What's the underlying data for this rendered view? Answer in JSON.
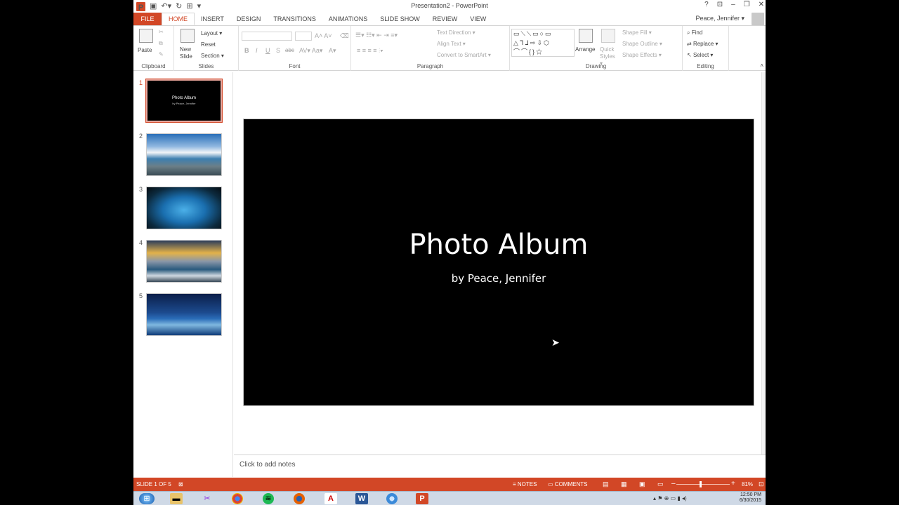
{
  "window": {
    "title": "Presentation2 - PowerPoint",
    "help": "?",
    "controls": [
      "restore-icon",
      "minimize-icon",
      "maximize-icon",
      "close-icon"
    ]
  },
  "user": {
    "name": "Peace, Jennifer ▾"
  },
  "tabs": [
    "FILE",
    "HOME",
    "INSERT",
    "DESIGN",
    "TRANSITIONS",
    "ANIMATIONS",
    "SLIDE SHOW",
    "REVIEW",
    "VIEW"
  ],
  "ribbon": {
    "clipboard": {
      "label": "Clipboard",
      "paste": "Paste"
    },
    "slides": {
      "label": "Slides",
      "new_slide": "New Slide",
      "layout": "Layout ▾",
      "reset": "Reset",
      "section": "Section ▾"
    },
    "font": {
      "label": "Font",
      "bold": "B",
      "italic": "I",
      "underline": "U",
      "shadow": "S",
      "strike": "abc"
    },
    "paragraph": {
      "label": "Paragraph",
      "text_direction": "Text Direction ▾",
      "align_text": "Align Text ▾",
      "smartart": "Convert to SmartArt ▾"
    },
    "drawing": {
      "label": "Drawing",
      "arrange": "Arrange",
      "quick_styles": "Quick Styles ▾",
      "shape_fill": "Shape Fill ▾",
      "shape_outline": "Shape Outline ▾",
      "shape_effects": "Shape Effects ▾"
    },
    "editing": {
      "label": "Editing",
      "find": "Find",
      "replace": "Replace ▾",
      "select": "Select ▾"
    }
  },
  "slides": [
    {
      "number": "1",
      "title": "Photo Album",
      "subtitle": "by Peace, Jennifer"
    },
    {
      "number": "2"
    },
    {
      "number": "3"
    },
    {
      "number": "4"
    },
    {
      "number": "5"
    }
  ],
  "current_slide": {
    "title": "Photo Album",
    "subtitle": "by Peace, Jennifer"
  },
  "notes_placeholder": "Click to add notes",
  "status": {
    "slide_info": "SLIDE 1 OF 5",
    "notes": "NOTES",
    "comments": "COMMENTS",
    "zoom": "81%",
    "zoom_level_percent": 81
  },
  "tray": {
    "time": "12:50 PM",
    "date": "6/30/2015"
  },
  "colors": {
    "accent": "#d24726",
    "slide_bg": "#000000"
  }
}
